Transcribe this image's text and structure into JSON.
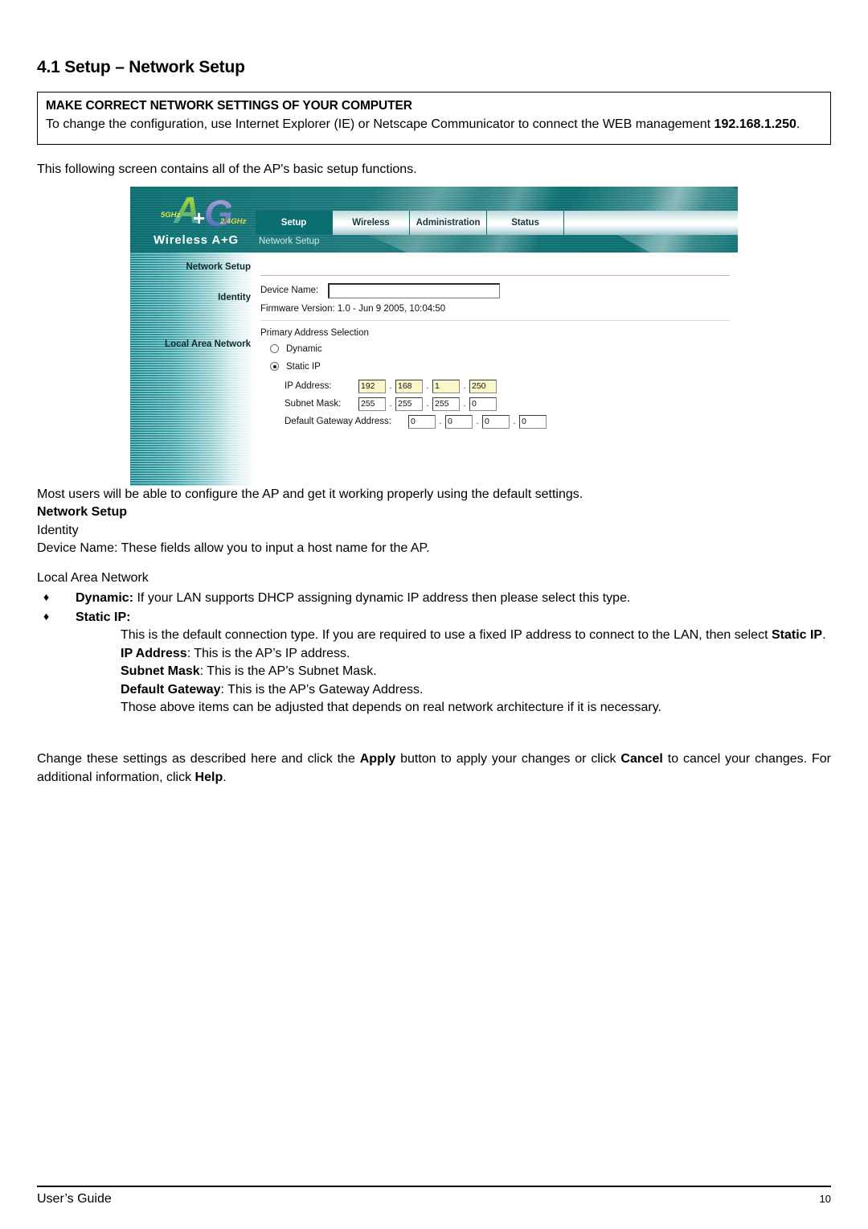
{
  "heading": "4.1 Setup – Network Setup",
  "notice": {
    "title": "MAKE CORRECT NETWORK SETTINGS OF YOUR COMPUTER",
    "body_part1": "To change the configuration, use Internet Explorer (IE) or Netscape Communicator to connect the WEB management ",
    "ip": "192.168.1.250",
    "body_part2": "."
  },
  "intro": "This following screen contains all of the AP's basic setup functions.",
  "screenshot": {
    "logo": {
      "letter_a": "A",
      "plus": "+",
      "letter_g": "G",
      "band_5ghz": "5GHz",
      "band_24ghz": "2.4GHz",
      "wordmark": "Wireless A+G"
    },
    "tabs": [
      {
        "label": "Setup",
        "active": true
      },
      {
        "label": "Wireless",
        "active": false
      },
      {
        "label": "Administration",
        "active": false
      },
      {
        "label": "Status",
        "active": false
      }
    ],
    "subtab": "Network Setup",
    "sidebar": [
      "Network Setup",
      "Identity",
      "Local Area Network"
    ],
    "fields": {
      "device_name_label": "Device Name:",
      "device_name_value": "",
      "firmware": "Firmware Version: 1.0 - Jun 9 2005, 10:04:50",
      "primary_address_selection": "Primary Address Selection",
      "dynamic_label": "Dynamic",
      "static_label": "Static IP",
      "ip_label": "IP Address:",
      "mask_label": "Subnet Mask:",
      "gw_label": "Default Gateway Address:"
    },
    "ip_address": [
      "192",
      "168",
      "1",
      "250"
    ],
    "subnet_mask": [
      "255",
      "255",
      "255",
      "0"
    ],
    "default_gateway": [
      "0",
      "0",
      "0",
      "0"
    ],
    "separator": ".",
    "colors": {
      "teal": "#0a6e70",
      "highlight_yellow": "#fbf8c9"
    }
  },
  "prose": {
    "line_default": "Most users will be able to configure the AP and get it working properly using the default settings.",
    "h_network_setup": "Network Setup",
    "identity": "Identity",
    "device_name_desc": "Device Name: These fields allow you to input a host name for the AP.",
    "lan_heading": "Local Area Network",
    "bullet_mark": "♦",
    "dynamic_term": "Dynamic:",
    "dynamic_desc": " If your LAN supports DHCP assigning dynamic IP address then please select this type.",
    "static_term": "Static IP:",
    "static_desc_1": "This is the default connection type. If you are required to use a fixed IP address to connect to the LAN, then select ",
    "static_desc_1_bold": "Static IP",
    "static_desc_1_end": ".",
    "ip_term": "IP Address",
    "ip_desc": ": This is the AP’s IP address.",
    "mask_term": "Subnet Mask",
    "mask_desc": ": This is the AP’s Subnet Mask.",
    "gw_term": "Default Gateway",
    "gw_desc": ": This is the AP’s Gateway Address.",
    "adjust_note": "Those above items can be adjusted that depends on real network architecture if it is necessary."
  },
  "closing": {
    "part1": "Change these settings as described here and click the ",
    "apply": "Apply",
    "part2": " button to apply your changes or click ",
    "cancel": "Cancel",
    "part3": " to cancel your changes. For additional information, click ",
    "help": "Help",
    "part4": "."
  },
  "footer": {
    "guide": "User’s Guide",
    "page": "10"
  }
}
